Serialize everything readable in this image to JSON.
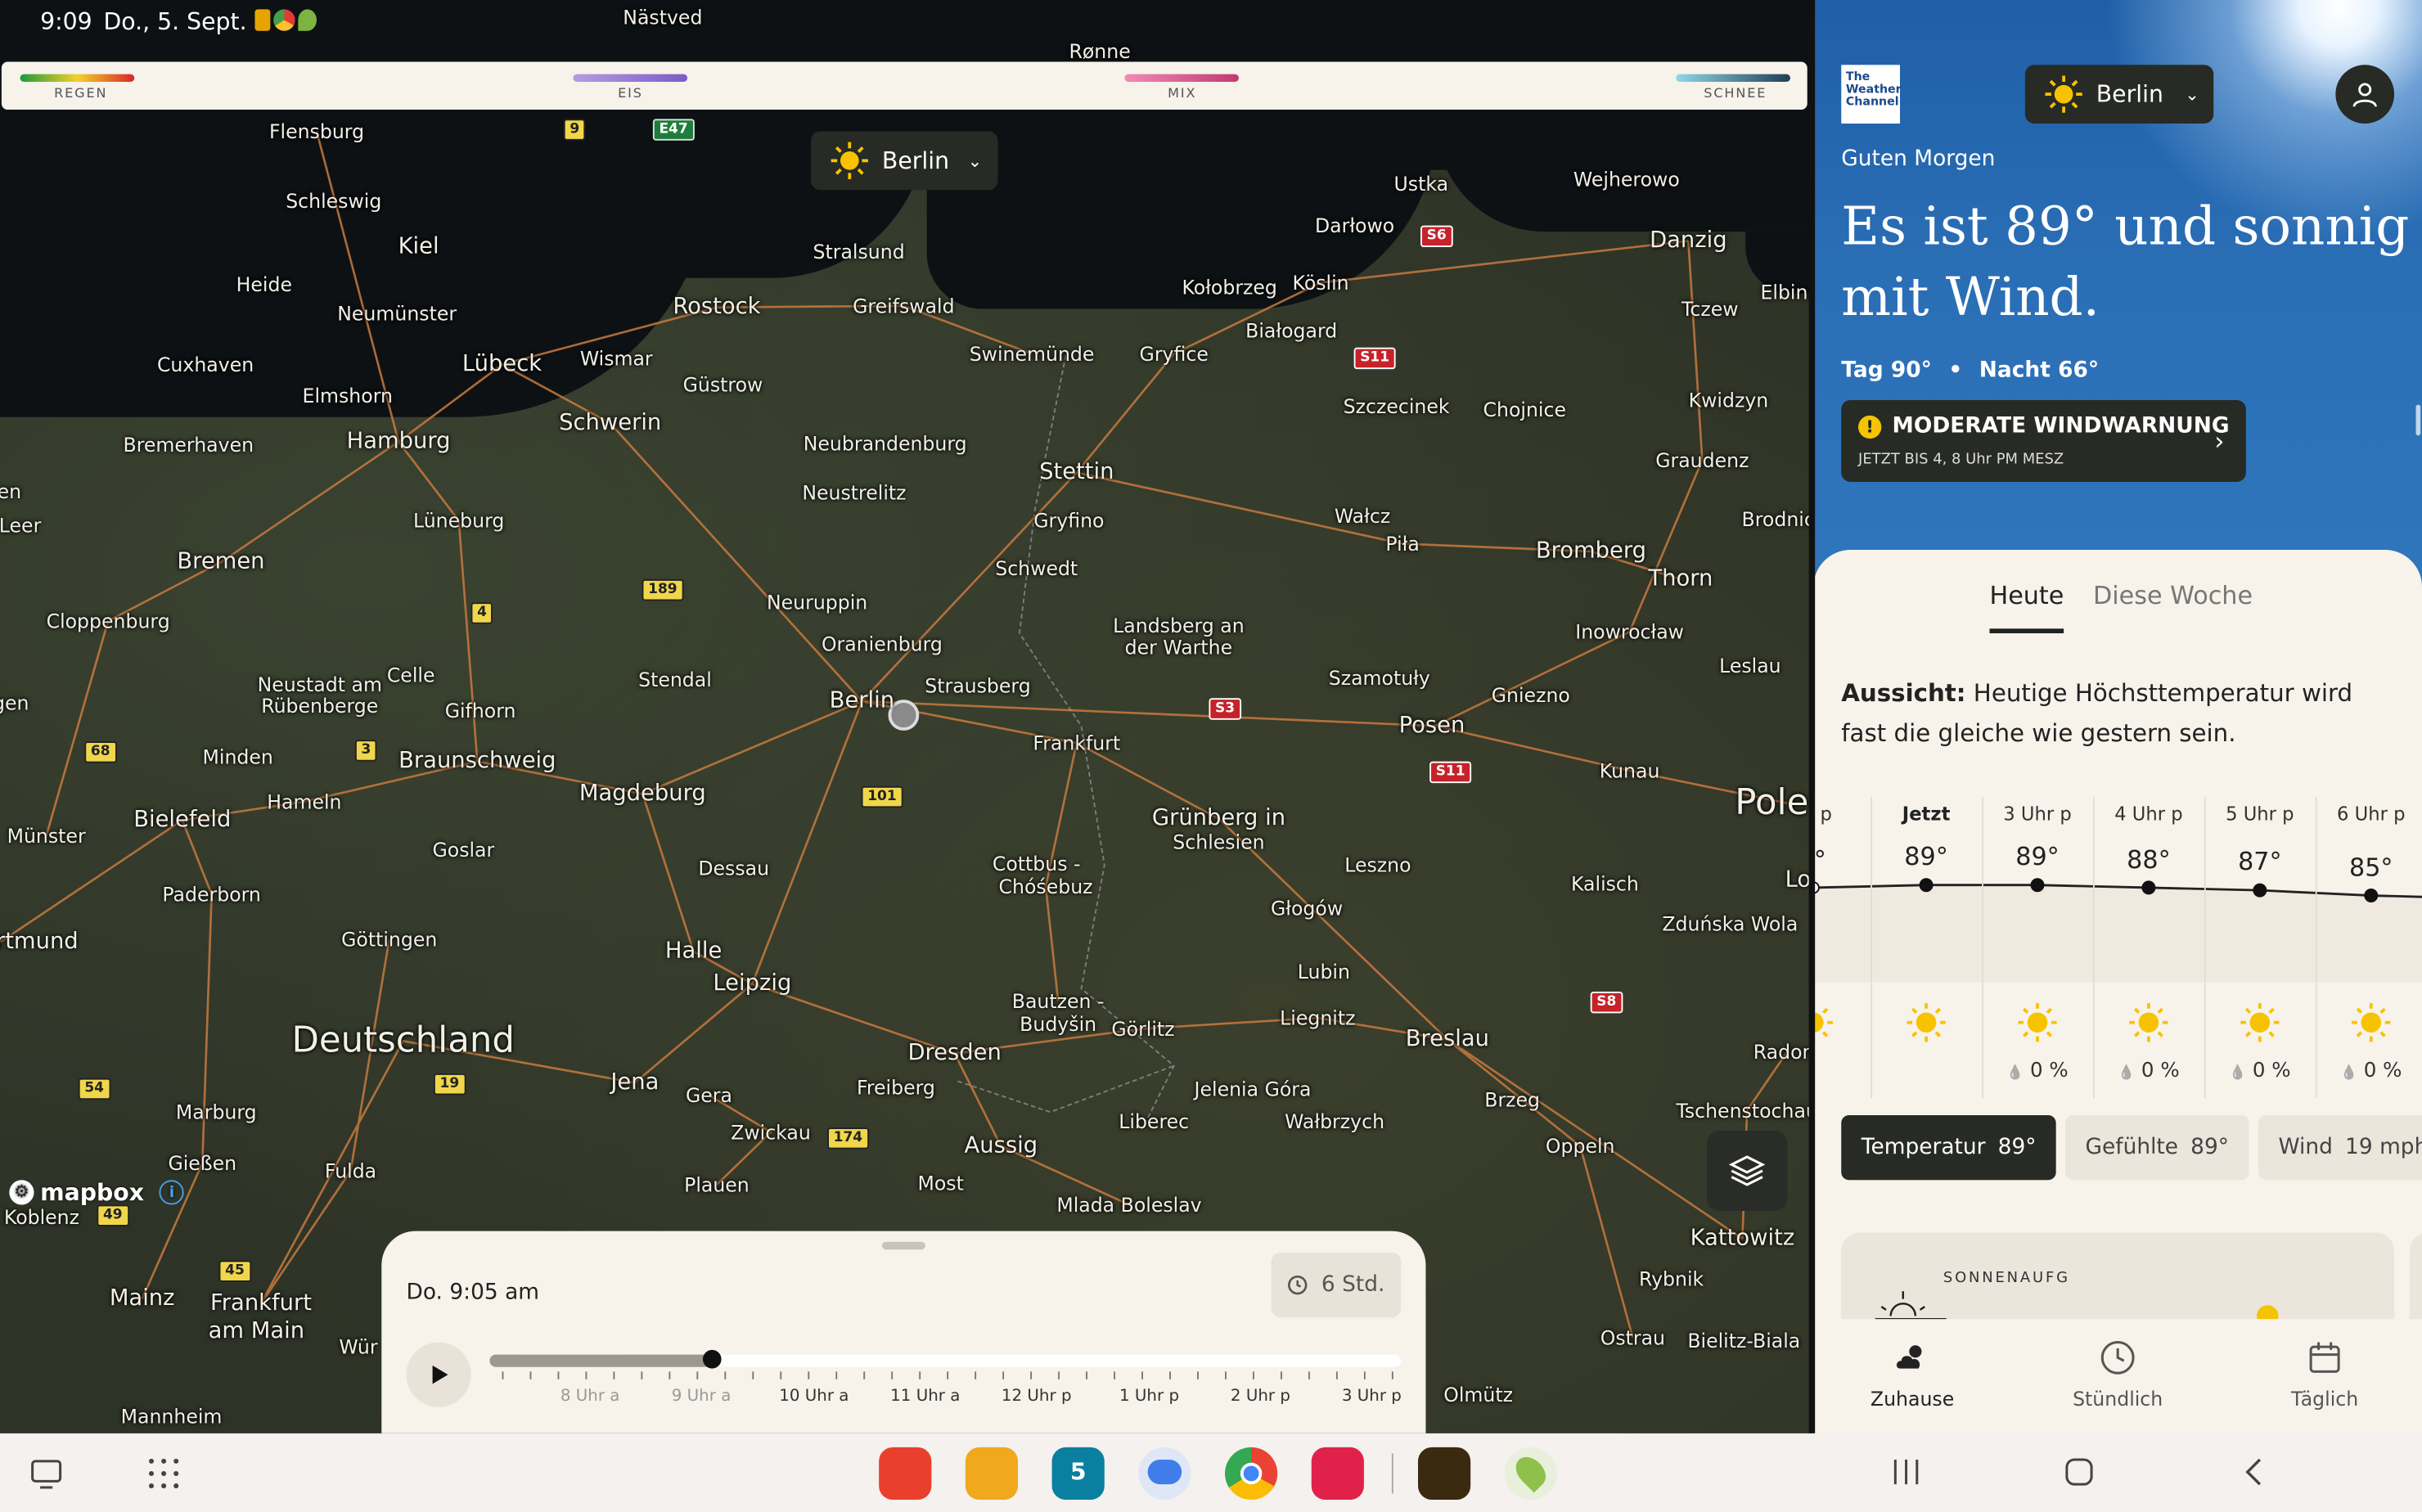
{
  "status_bar": {
    "time": "9:09",
    "date": "Do., 5. Sept."
  },
  "legend": {
    "items": [
      {
        "label": "REGEN",
        "colors": [
          "#1a9b3c",
          "#f3d22a",
          "#d8262a"
        ]
      },
      {
        "label": "EIS",
        "colors": [
          "#b69be0",
          "#7a5cc8"
        ]
      },
      {
        "label": "MIX",
        "colors": [
          "#f08bb4",
          "#c03a74"
        ]
      },
      {
        "label": "SCHNEE",
        "colors": [
          "#8fd8e8",
          "#1f3f55"
        ]
      }
    ]
  },
  "map": {
    "location_pill": {
      "city": "Berlin"
    },
    "attribution": "mapbox",
    "cities": [
      [
        "Flensburg",
        205,
        85,
        "s"
      ],
      [
        "Schleswig",
        216,
        130,
        "s"
      ],
      [
        "Kiel",
        271,
        160,
        "m"
      ],
      [
        "Heide",
        171,
        184,
        "s"
      ],
      [
        "Neumünster",
        257,
        203,
        "s"
      ],
      [
        "Cuxhaven",
        133,
        236,
        "s"
      ],
      [
        "Lübeck",
        325,
        236,
        "m"
      ],
      [
        "Wismar",
        399,
        232,
        "s"
      ],
      [
        "Rostock",
        464,
        199,
        "m"
      ],
      [
        "Stralsund",
        556,
        163,
        "s"
      ],
      [
        "Greifswald",
        585,
        198,
        "s"
      ],
      [
        "Elmshorn",
        225,
        256,
        "s"
      ],
      [
        "Güstrow",
        468,
        249,
        "s"
      ],
      [
        "Bremerhaven",
        122,
        288,
        "s"
      ],
      [
        "Hamburg",
        258,
        286,
        "m"
      ],
      [
        "Schwerin",
        395,
        274,
        "m"
      ],
      [
        "Neubrandenburg",
        573,
        287,
        "s"
      ],
      [
        "Swinemünde",
        668,
        229,
        "s"
      ],
      [
        "Gryfice",
        760,
        229,
        "s"
      ],
      [
        "Kołobrzeg",
        796,
        186,
        "s"
      ],
      [
        "Köslin",
        855,
        183,
        "s"
      ],
      [
        "Białogard",
        836,
        214,
        "s"
      ],
      [
        "Darłowo",
        877,
        146,
        "s"
      ],
      [
        "Ustka",
        920,
        119,
        "s"
      ],
      [
        "Wejherowo",
        1053,
        116,
        "s"
      ],
      [
        "Danzig",
        1093,
        156,
        "m"
      ],
      [
        "Tczew",
        1107,
        200,
        "s"
      ],
      [
        "Kwidzyn",
        1119,
        259,
        "s"
      ],
      [
        "Graudenz",
        1102,
        298,
        "s"
      ],
      [
        "Chojnice",
        987,
        265,
        "s"
      ],
      [
        "Szczecinek",
        904,
        263,
        "s"
      ],
      [
        "Leer",
        13,
        340,
        "s"
      ],
      [
        "Lüneburg",
        297,
        337,
        "s"
      ],
      [
        "Neustrelitz",
        553,
        319,
        "s"
      ],
      [
        "Stettin",
        697,
        306,
        "m"
      ],
      [
        "Gryfino",
        692,
        337,
        "s"
      ],
      [
        "Wałcz",
        882,
        334,
        "s"
      ],
      [
        "Piła",
        908,
        352,
        "s"
      ],
      [
        "Bromberg",
        1030,
        357,
        "m"
      ],
      [
        "Thorn",
        1088,
        375,
        "m"
      ],
      [
        "Bremen",
        143,
        364,
        "m"
      ],
      [
        "Schwedt",
        671,
        368,
        "s"
      ],
      [
        "Neuruppin",
        529,
        390,
        "s"
      ],
      [
        "Cloppenburg",
        70,
        402,
        "s"
      ],
      [
        "Oranienburg",
        571,
        417,
        "s"
      ],
      [
        "Landsberg an",
        763,
        405,
        "s"
      ],
      [
        "der Warthe",
        763,
        419,
        "s"
      ],
      [
        "Inowrocław",
        1055,
        409,
        "s"
      ],
      [
        "Leslau",
        1133,
        431,
        "s"
      ],
      [
        "Neustadt am",
        207,
        443,
        "s"
      ],
      [
        "Rübenberge",
        207,
        457,
        "s"
      ],
      [
        "Celle",
        266,
        437,
        "s"
      ],
      [
        "Stendal",
        437,
        440,
        "s"
      ],
      [
        "Strausberg",
        633,
        444,
        "s"
      ],
      [
        "Szamotuły",
        893,
        439,
        "s"
      ],
      [
        "Gniezno",
        991,
        450,
        "s"
      ],
      [
        "Berlin",
        558,
        454,
        "m"
      ],
      [
        "Gifhorn",
        311,
        460,
        "s"
      ],
      [
        "Posen",
        927,
        470,
        "m"
      ],
      [
        "Frankfurt",
        697,
        481,
        "s"
      ],
      [
        "Minden",
        154,
        490,
        "s"
      ],
      [
        "Braunschweig",
        309,
        493,
        "m"
      ],
      [
        "Kunau",
        1055,
        499,
        "s"
      ],
      [
        "Magdeburg",
        416,
        514,
        "m"
      ],
      [
        "Hameln",
        197,
        519,
        "s"
      ],
      [
        "Bielefeld",
        118,
        531,
        "m"
      ],
      [
        "Grünberg in",
        789,
        530,
        "m"
      ],
      [
        "Schlesien",
        789,
        545,
        "s"
      ],
      [
        "Münster",
        30,
        541,
        "s"
      ],
      [
        "Goslar",
        300,
        550,
        "s"
      ],
      [
        "Dessau",
        475,
        562,
        "s"
      ],
      [
        "Cottbus -",
        671,
        559,
        "s"
      ],
      [
        "Chóśebuz",
        677,
        574,
        "s"
      ],
      [
        "Leszno",
        892,
        560,
        "s"
      ],
      [
        "Kalisch",
        1039,
        572,
        "s"
      ],
      [
        "Paderborn",
        137,
        579,
        "s"
      ],
      [
        "Głogów",
        846,
        588,
        "s"
      ],
      [
        "Zduńska Wola",
        1120,
        598,
        "s"
      ],
      [
        "rtmund",
        24,
        610,
        "m"
      ],
      [
        "Göttingen",
        252,
        608,
        "s"
      ],
      [
        "Halle",
        449,
        616,
        "m"
      ],
      [
        "Lubin",
        857,
        629,
        "s"
      ],
      [
        "Leipzig",
        487,
        637,
        "m"
      ],
      [
        "Bautzen -",
        685,
        648,
        "s"
      ],
      [
        "Budyšin",
        685,
        663,
        "s"
      ],
      [
        "Görlitz",
        740,
        666,
        "s"
      ],
      [
        "Liegnitz",
        853,
        659,
        "s"
      ],
      [
        "Breslau",
        937,
        673,
        "m"
      ],
      [
        "Deutschland",
        261,
        674,
        "l"
      ],
      [
        "Dresden",
        618,
        682,
        "m"
      ],
      [
        "Jena",
        411,
        701,
        "m"
      ],
      [
        "Freiberg",
        580,
        704,
        "s"
      ],
      [
        "Jelenia Góra",
        811,
        705,
        "s"
      ],
      [
        "Gera",
        459,
        709,
        "s"
      ],
      [
        "Brzeg",
        979,
        712,
        "s"
      ],
      [
        "Marburg",
        140,
        720,
        "s"
      ],
      [
        "Wałbrzych",
        864,
        726,
        "s"
      ],
      [
        "Liberec",
        747,
        726,
        "s"
      ],
      [
        "Zwickau",
        499,
        733,
        "s"
      ],
      [
        "Aussig",
        648,
        742,
        "m"
      ],
      [
        "Oppeln",
        1023,
        742,
        "s"
      ],
      [
        "Gießen",
        131,
        753,
        "s"
      ],
      [
        "Fulda",
        227,
        758,
        "s"
      ],
      [
        "Plauen",
        464,
        767,
        "s"
      ],
      [
        "Most",
        609,
        766,
        "s"
      ],
      [
        "Mlada Boleslav",
        731,
        780,
        "s"
      ],
      [
        "Koblenz",
        27,
        788,
        "s"
      ],
      [
        "Kattowitz",
        1128,
        802,
        "m"
      ],
      [
        "Rybnik",
        1082,
        828,
        "s"
      ],
      [
        "Mainz",
        92,
        841,
        "m"
      ],
      [
        "Frankfurt",
        169,
        844,
        "m"
      ],
      [
        "am Main",
        166,
        862,
        "m"
      ],
      [
        "Wür",
        232,
        872,
        "s"
      ],
      [
        "Ostrau",
        1057,
        866,
        "s"
      ],
      [
        "Bielitz-Biala",
        1129,
        868,
        "s"
      ],
      [
        "Mannheim",
        111,
        917,
        "s"
      ],
      [
        "Olmütz",
        957,
        903,
        "s"
      ],
      [
        "Radom",
        1157,
        681,
        "s"
      ],
      [
        "Tschenstochau",
        1131,
        719,
        "s"
      ],
      [
        "Elbing",
        1159,
        189,
        "s"
      ],
      [
        "Brodnica",
        1155,
        336,
        "s"
      ],
      [
        "Lo",
        1164,
        570,
        "m"
      ],
      [
        "Pole",
        1147,
        520,
        "l"
      ],
      [
        "Nästved",
        429,
        11,
        "s"
      ],
      [
        "Rønne",
        712,
        33,
        "s"
      ],
      [
        "en",
        6,
        318,
        "s"
      ],
      [
        "gen",
        7,
        455,
        "s"
      ]
    ],
    "shields": [
      [
        "9",
        372,
        84,
        "y"
      ],
      [
        "E47",
        436,
        84,
        "g"
      ],
      [
        "S6",
        930,
        153,
        "r"
      ],
      [
        "S11",
        890,
        232,
        "r"
      ],
      [
        "189",
        429,
        382,
        "y"
      ],
      [
        "4",
        312,
        397,
        "y"
      ],
      [
        "S3",
        793,
        459,
        "r"
      ],
      [
        "68",
        65,
        487,
        "y"
      ],
      [
        "3",
        237,
        486,
        "y"
      ],
      [
        "S11",
        939,
        500,
        "r"
      ],
      [
        "101",
        571,
        516,
        "y"
      ],
      [
        "S8",
        1040,
        649,
        "r"
      ],
      [
        "19",
        291,
        702,
        "y"
      ],
      [
        "54",
        61,
        705,
        "y"
      ],
      [
        "174",
        549,
        737,
        "y"
      ],
      [
        "49",
        73,
        787,
        "y"
      ],
      [
        "45",
        152,
        823,
        "y"
      ]
    ]
  },
  "timeline": {
    "date_time": "Do. 9:05 am",
    "range_label": "6 Std.",
    "progress": 0.244,
    "hour_labels": [
      "8 Uhr a",
      "9 Uhr a",
      "10 Uhr a",
      "11 Uhr a",
      "12 Uhr p",
      "1 Uhr p",
      "2 Uhr p",
      "3 Uhr p"
    ]
  },
  "panel": {
    "brand_lines": [
      "The",
      "Weather",
      "Channel"
    ],
    "location_pill": {
      "city": "Berlin"
    },
    "greeting": "Guten Morgen",
    "headline": "Es ist 89° und sonnig mit Wind.",
    "day_label": "Tag 90°",
    "night_label": "Nacht 66°",
    "separator": "•",
    "alert": {
      "title": "MODERATE WINDWARNUNG",
      "subtitle": "JETZT BIS 4, 8 Uhr PM MESZ"
    },
    "tabs": [
      "Heute",
      "Diese Woche"
    ],
    "outlook_label": "Aussicht:",
    "outlook_text": "Heutige Höchsttemperatur wird fast die gleiche wie gestern sein.",
    "hourly": [
      {
        "label": "hr p",
        "temp": "?°",
        "pop": ""
      },
      {
        "label": "Jetzt",
        "temp": "89°",
        "pop": ""
      },
      {
        "label": "3 Uhr p",
        "temp": "89°",
        "pop": "0 %"
      },
      {
        "label": "4 Uhr p",
        "temp": "88°",
        "pop": "0 %"
      },
      {
        "label": "5 Uhr p",
        "temp": "87°",
        "pop": "0 %"
      },
      {
        "label": "6 Uhr p",
        "temp": "85°",
        "pop": "0 %"
      }
    ],
    "chips": [
      {
        "label": "Temperatur",
        "value": "89°"
      },
      {
        "label": "Gefühlte",
        "value": "89°"
      },
      {
        "label": "Wind",
        "value": "19 mph"
      }
    ],
    "sun_card_label": "SONNENAUFG",
    "nav": [
      "Zuhause",
      "Stündlich",
      "Täglich"
    ]
  },
  "taskbar": {
    "apps": [
      {
        "name": "sticky-notes",
        "color": "#e8402c"
      },
      {
        "name": "files",
        "color": "#f0a81c"
      },
      {
        "name": "calendar",
        "color": "#0a7f9f",
        "text": "5"
      },
      {
        "name": "messages",
        "color": "#3f7ee8"
      },
      {
        "name": "chrome",
        "color": "#ffffff"
      },
      {
        "name": "camera",
        "color": "#e0224b"
      },
      {
        "name": "game",
        "color": "#3a2a10"
      },
      {
        "name": "maps",
        "color": "#8fc04a"
      }
    ]
  }
}
